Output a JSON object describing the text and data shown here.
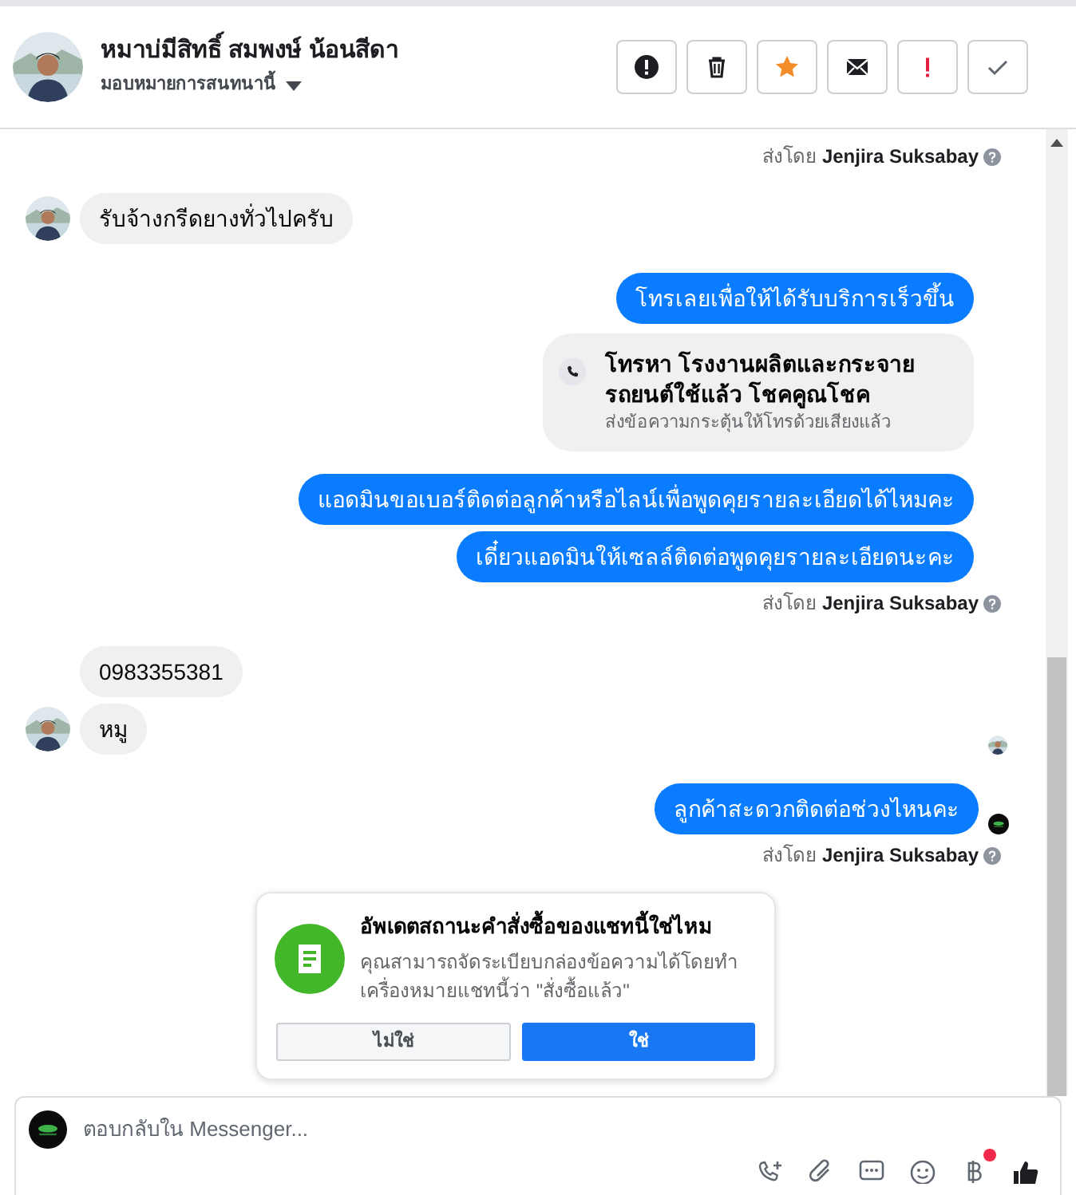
{
  "header": {
    "name": "หมาบ่มีสิทธิ์ สมพงษ์ น้อนสีดา",
    "subtitle": "มอบหมายการสนทนานี้",
    "actions": [
      {
        "kind": "spam"
      },
      {
        "kind": "delete"
      },
      {
        "kind": "star"
      },
      {
        "kind": "unread"
      },
      {
        "kind": "important"
      },
      {
        "kind": "done"
      }
    ]
  },
  "messages": [
    {
      "kind": "sent_by",
      "prefix": "ส่งโดย",
      "agent": "Jenjira Suksabay"
    },
    {
      "kind": "incoming",
      "text": "รับจ้างกรีดยางทั่วไปครับ",
      "avatar": true
    },
    {
      "kind": "outgoing",
      "text": "โทรเลยเพื่อให้ได้รับบริการเร็วขึ้น"
    },
    {
      "kind": "call_card",
      "title": "โทรหา โรงงานผลิตและกระจายรถยนต์ใช้แล้ว โชคคูณโชค",
      "subtitle": "ส่งข้อความกระตุ้นให้โทรด้วยเสียงแล้ว"
    },
    {
      "kind": "outgoing",
      "text": "แอดมินขอเบอร์ติดต่อลูกค้าหรือไลน์เพื่อพูดคุยรายละเอียดได้ไหมคะ"
    },
    {
      "kind": "outgoing",
      "text": "เดี๋ยวแอดมินให้เซลล์ติดต่อพูดคุยรายละเอียดนะคะ"
    },
    {
      "kind": "sent_by",
      "prefix": "ส่งโดย",
      "agent": "Jenjira Suksabay"
    },
    {
      "kind": "incoming",
      "text": "0983355381",
      "avatar": false
    },
    {
      "kind": "incoming",
      "text": "หมู",
      "avatar": true,
      "seen": true
    },
    {
      "kind": "outgoing",
      "text": "ลูกค้าสะดวกติดต่อช่วงไหนคะ",
      "seen": true
    },
    {
      "kind": "sent_by",
      "prefix": "ส่งโดย",
      "agent": "Jenjira Suksabay"
    },
    {
      "kind": "order_prompt",
      "title": "อัพเดตสถานะคำสั่งซื้อของแชทนี้ใช่ไหม",
      "body": "คุณสามารถจัดระเบียบกล่องข้อความได้โดยทำเครื่องหมายแชทนี้ว่า \"สั่งซื้อแล้ว\"",
      "no": "ไม่ใช่",
      "yes": "ใช่"
    }
  ],
  "composer": {
    "placeholder": "ตอบกลับใน Messenger...",
    "tools": [
      {
        "kind": "call",
        "dot": false
      },
      {
        "kind": "attach",
        "dot": false
      },
      {
        "kind": "reply",
        "dot": false
      },
      {
        "kind": "emoji",
        "dot": false
      },
      {
        "kind": "payment",
        "dot": true
      },
      {
        "kind": "like",
        "dot": false
      }
    ]
  }
}
